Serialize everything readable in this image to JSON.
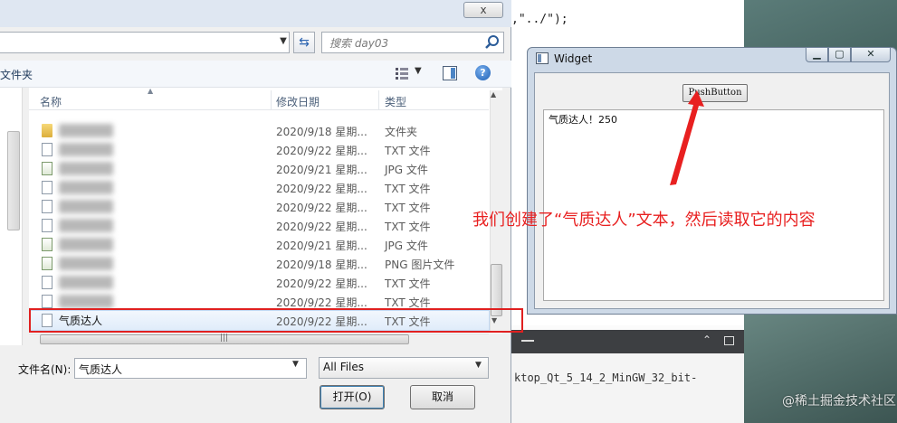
{
  "editor": {
    "code_line": ",\"../\");",
    "bottom_output": "ktop_Qt_5_14_2_MinGW_32_bit-"
  },
  "file_dialog": {
    "close_label": "x",
    "search_placeholder": "搜索 day03",
    "toolbar_label": "文件夹",
    "columns": {
      "name": "名称",
      "date": "修改日期",
      "type": "类型"
    },
    "rows": [
      {
        "icon": "folder-icon",
        "date": "2020/9/18 星期...",
        "type": "文件夹"
      },
      {
        "icon": "text-file-icon",
        "date": "2020/9/22 星期...",
        "type": "TXT 文件"
      },
      {
        "icon": "image-file-icon",
        "date": "2020/9/21 星期...",
        "type": "JPG 文件"
      },
      {
        "icon": "text-file-icon",
        "date": "2020/9/22 星期...",
        "type": "TXT 文件"
      },
      {
        "icon": "text-file-icon",
        "date": "2020/9/22 星期...",
        "type": "TXT 文件"
      },
      {
        "icon": "text-file-icon",
        "date": "2020/9/22 星期...",
        "type": "TXT 文件"
      },
      {
        "icon": "image-file-icon",
        "date": "2020/9/21 星期...",
        "type": "JPG 文件"
      },
      {
        "icon": "image-file-icon",
        "date": "2020/9/18 星期...",
        "type": "PNG 图片文件"
      },
      {
        "icon": "text-file-icon",
        "date": "2020/9/22 星期...",
        "type": "TXT 文件"
      },
      {
        "icon": "text-file-icon",
        "date": "2020/9/22 星期...",
        "type": "TXT 文件"
      }
    ],
    "selected_row": {
      "name": "气质达人",
      "date": "2020/9/22 星期...",
      "type": "TXT 文件"
    },
    "filename_label": "文件名(N):",
    "filename_value": "气质达人",
    "filetype_value": "All Files",
    "open_button": "打开(O)",
    "cancel_button": "取消"
  },
  "widget": {
    "title": "Widget",
    "push_button": "PushButton",
    "text_content": "气质达人！250"
  },
  "annotation": "我们创建了“气质达人”文本，然后读取它的内容",
  "watermark": "@稀土掘金技术社区",
  "colors": {
    "annotation_red": "#e82020",
    "selection_blue": "#e0ecfa"
  }
}
